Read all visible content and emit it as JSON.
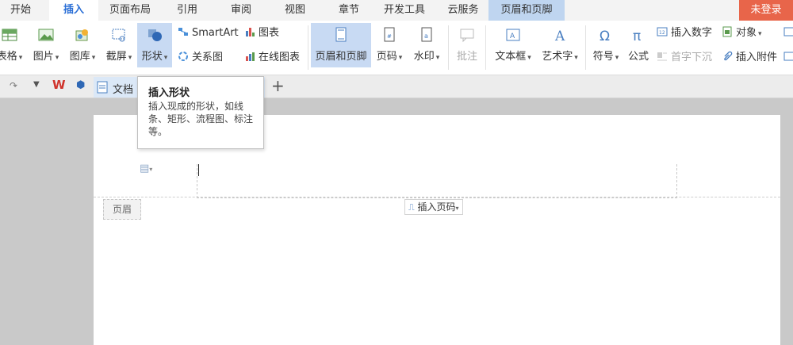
{
  "menu": {
    "tabs": [
      "开始",
      "插入",
      "页面布局",
      "引用",
      "审阅",
      "视图",
      "章节",
      "开发工具",
      "云服务",
      "页眉和页脚"
    ],
    "active": "插入",
    "login": "未登录"
  },
  "ribbon": {
    "table": "表格",
    "picture": "图片",
    "gallery": "图库",
    "screenshot": "截屏",
    "shape": "形状",
    "smartart": "SmartArt",
    "relation": "关系图",
    "chart": "图表",
    "online_chart": "在线图表",
    "header_footer": "页眉和页脚",
    "page_number": "页码",
    "watermark": "水印",
    "comment": "批注",
    "textbox": "文本框",
    "wordart": "艺术字",
    "symbol": "符号",
    "formula": "公式",
    "insert_number": "插入数字",
    "object": "对象",
    "drop_cap": "首字下沉",
    "insert_attachment": "插入附件"
  },
  "docbar": {
    "doc_title": "文档"
  },
  "tooltip": {
    "title": "插入形状",
    "desc": "插入现成的形状，如线条、矩形、流程图、标注等。"
  },
  "page": {
    "header_label": "页眉",
    "insert_page_number": "插入页码"
  },
  "colors": {
    "accent": "#2b6fd6",
    "login_bg": "#e8654a",
    "context_tab": "#bfd5f0"
  }
}
